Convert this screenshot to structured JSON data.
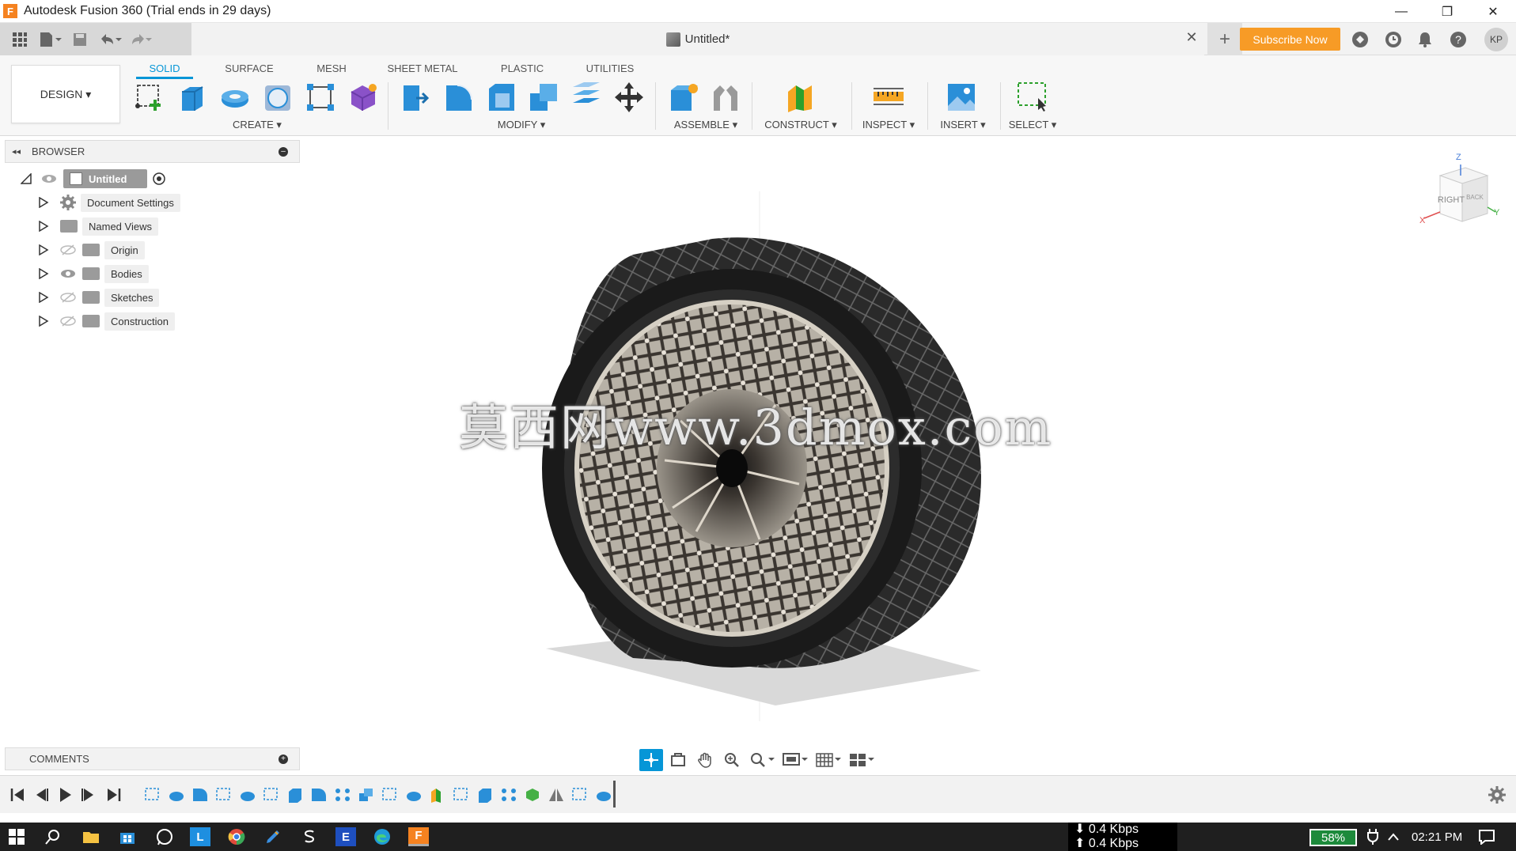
{
  "window": {
    "title": "Autodesk Fusion 360 (Trial ends in 29 days)",
    "logo_letter": "F",
    "controls": [
      "—",
      "❐",
      "✕"
    ]
  },
  "header": {
    "doc_title": "Untitled*",
    "close_glyph": "✕",
    "new_tab_glyph": "+",
    "subscribe_label": "Subscribe Now",
    "avatar_initials": "KP"
  },
  "ribbon": {
    "workspace_label": "DESIGN ▾",
    "tabs": [
      {
        "label": "SOLID",
        "active": true
      },
      {
        "label": "SURFACE",
        "active": false
      },
      {
        "label": "MESH",
        "active": false
      },
      {
        "label": "SHEET METAL",
        "active": false
      },
      {
        "label": "PLASTIC",
        "active": false
      },
      {
        "label": "UTILITIES",
        "active": false
      }
    ],
    "groups": {
      "create": "CREATE ▾",
      "modify": "MODIFY ▾",
      "assemble": "ASSEMBLE ▾",
      "construct": "CONSTRUCT ▾",
      "inspect": "INSPECT ▾",
      "insert": "INSERT ▾",
      "select": "SELECT ▾"
    }
  },
  "browser": {
    "title": "BROWSER",
    "collapse_glyph": "◂◂",
    "minus_glyph": "–",
    "root": "Untitled",
    "items": [
      {
        "label": "Document Settings"
      },
      {
        "label": "Named Views"
      },
      {
        "label": "Origin"
      },
      {
        "label": "Bodies"
      },
      {
        "label": "Sketches"
      },
      {
        "label": "Construction"
      }
    ]
  },
  "viewport": {
    "watermark": "莫西网www.3dmox.com",
    "viewcube": {
      "face_right": "RIGHT",
      "face_back": "BACK",
      "axis_z": "Z",
      "axis_x": "X",
      "axis_y": "Y"
    }
  },
  "comments": {
    "title": "COMMENTS",
    "plus_glyph": "+"
  },
  "taskbar": {
    "net_down": "⬇ 0.4 Kbps",
    "net_up": "⬆ 0.4 Kbps",
    "battery": "58%",
    "time": "02:21 PM",
    "app_letter_l": "L",
    "app_letter_e": "E",
    "app_letter_f": "F"
  },
  "colors": {
    "accent": "#0696d7",
    "subscribe": "#f79b26",
    "taskbar": "#1f1f1f",
    "battery": "#1d8a3b"
  }
}
